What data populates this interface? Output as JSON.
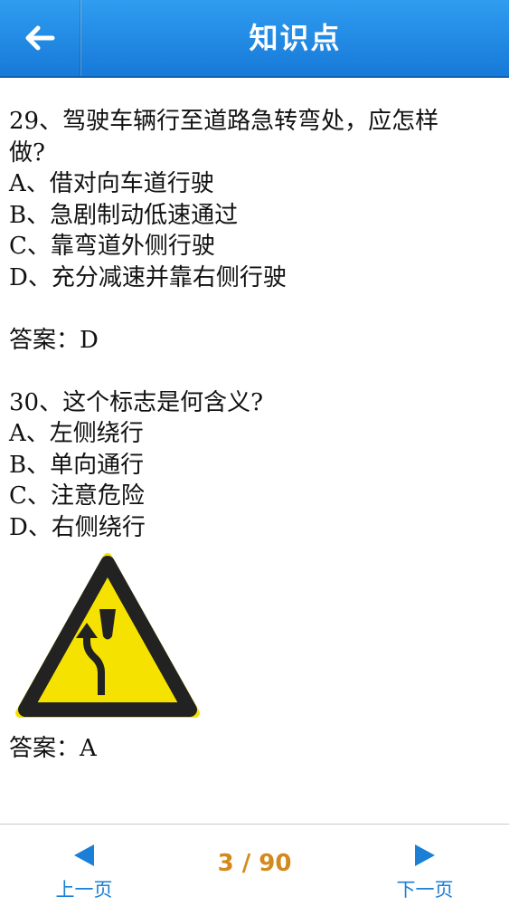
{
  "header": {
    "title": "知识点",
    "back_icon": "arrow-left-icon"
  },
  "questions": [
    {
      "q_line1": "29、驾驶车辆行至道路急转弯处，应怎样",
      "q_line2": "做?",
      "options": [
        "A、借对向车道行驶",
        "B、急剧制动低速通过",
        "C、靠弯道外侧行驶",
        "D、充分减速并靠右侧行驶"
      ],
      "answer": "答案：D"
    },
    {
      "q_line1": "30、这个标志是何含义?",
      "options": [
        "A、左侧绕行",
        "B、单向通行",
        "C、注意危险",
        "D、右侧绕行"
      ],
      "answer": "答案：A",
      "sign_icon": "keep-left-warning-sign-icon"
    }
  ],
  "footer": {
    "prev_label": "上一页",
    "next_label": "下一页",
    "page_indicator": "3 / 90"
  },
  "colors": {
    "header": "#1f88e5",
    "pager": "#d4891c",
    "nav": "#1b7fd6"
  }
}
